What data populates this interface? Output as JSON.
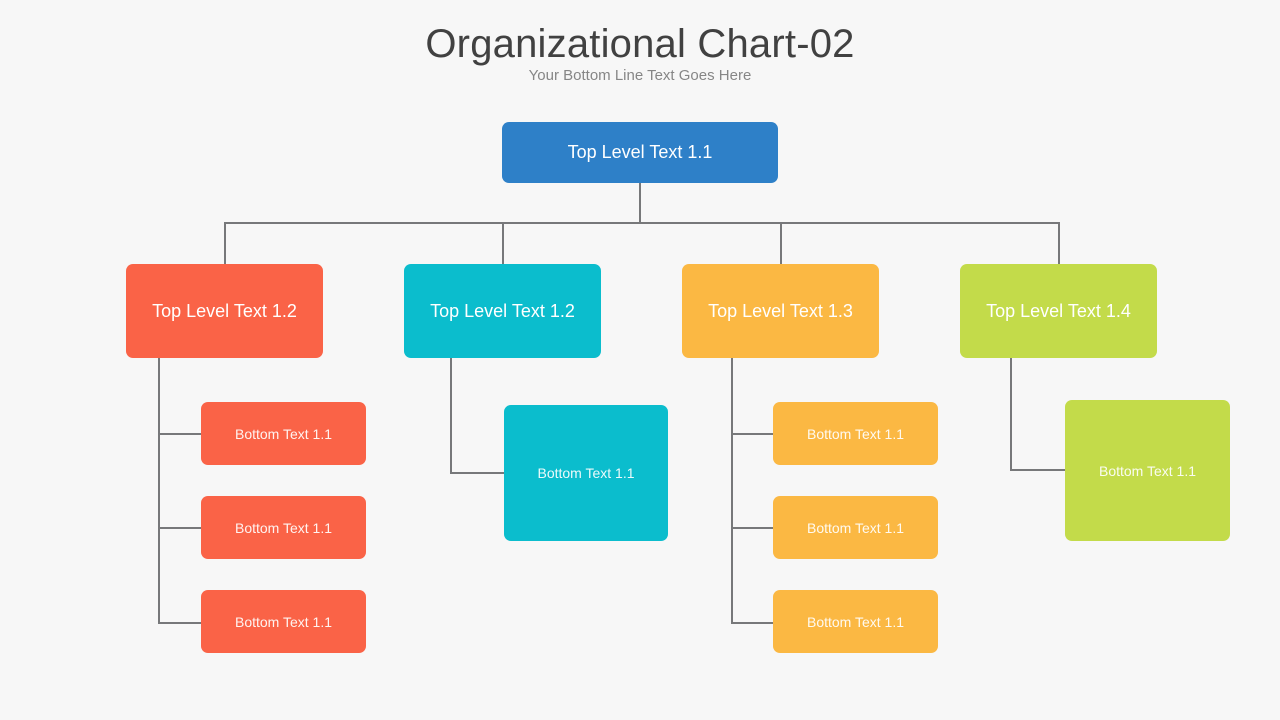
{
  "header": {
    "title": "Organizational Chart-02",
    "subtitle": "Your Bottom Line Text Goes Here"
  },
  "palette": {
    "background": "#f7f7f7",
    "connector": "#77787a",
    "title_color": "#414141",
    "subtitle_color": "#868686",
    "blue": "#2e80c8",
    "red": "#fa6347",
    "cyan": "#0bbdcd",
    "orange": "#fbb843",
    "green": "#c3db4a"
  },
  "chart_data": {
    "type": "diagram",
    "title": "Organizational Chart-02",
    "subtitle": "Your Bottom Line Text Goes Here",
    "root": {
      "label": "Top Level Text 1.1",
      "color": "#2e80c8"
    },
    "branches": [
      {
        "label": "Top Level Text 1.2",
        "color": "#fa6347",
        "children": [
          {
            "label": "Bottom Text  1.1"
          },
          {
            "label": "Bottom Text  1.1"
          },
          {
            "label": "Bottom Text  1.1"
          }
        ]
      },
      {
        "label": "Top Level Text 1.2",
        "color": "#0bbdcd",
        "children": [
          {
            "label": "Bottom Text  1.1"
          }
        ]
      },
      {
        "label": "Top Level Text 1.3",
        "color": "#fbb843",
        "children": [
          {
            "label": "Bottom Text  1.1"
          },
          {
            "label": "Bottom Text  1.1"
          },
          {
            "label": "Bottom Text  1.1"
          }
        ]
      },
      {
        "label": "Top Level Text 1.4",
        "color": "#c3db4a",
        "children": [
          {
            "label": "Bottom Text  1.1"
          }
        ]
      }
    ]
  }
}
